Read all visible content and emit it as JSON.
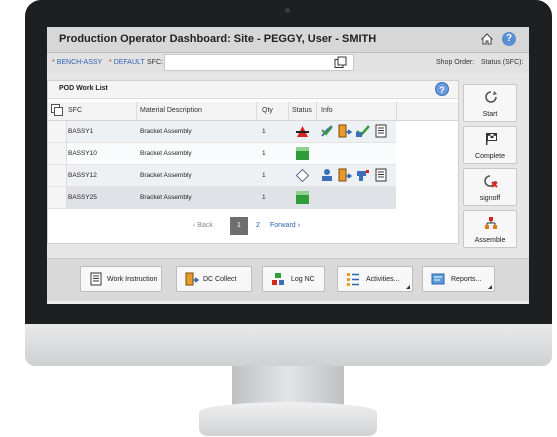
{
  "header": {
    "title": "Production Operator Dashboard: Site - PEGGY, User - SMITH",
    "home_icon": "home-icon",
    "help_icon": "help-icon",
    "help_glyph": "?"
  },
  "input_bar": {
    "operation_value": "BENCH-ASSY",
    "resource_value": "DEFAULT",
    "sfc_label": "SFC:",
    "sfc_value": "",
    "shop_order_label": "Shop Order:",
    "status_label": "Status (SFC):",
    "bullet": "*"
  },
  "worklist": {
    "title": "POD Work List",
    "help_glyph": "?",
    "columns": [
      "SFC",
      "Material Description",
      "Qty",
      "Status",
      "Info"
    ],
    "rows": [
      {
        "sfc": "BASSY1",
        "description": "Bracket Assembly",
        "qty": "1",
        "status": "on-hold",
        "info": [
          "routing-icon",
          "dc-collect-icon",
          "check-icon",
          "work-instruction-icon"
        ]
      },
      {
        "sfc": "BASSY10",
        "description": "Bracket Assembly",
        "qty": "1",
        "status": "active",
        "info": []
      },
      {
        "sfc": "BASSY12",
        "description": "Bracket Assembly",
        "qty": "1",
        "status": "new",
        "info": [
          "user-icon",
          "dc-collect-icon",
          "nc-icon",
          "work-instruction-icon"
        ]
      },
      {
        "sfc": "BASSY25",
        "description": "Bracket Assembly",
        "qty": "1",
        "status": "active",
        "info": []
      }
    ],
    "pager": {
      "back": "Back",
      "current": "1",
      "next_page": "2",
      "forward": "Forward"
    }
  },
  "actions": [
    {
      "label": "Start",
      "icon": "start-icon"
    },
    {
      "label": "Complete",
      "icon": "complete-flag-icon"
    },
    {
      "label": "signoff",
      "icon": "signoff-icon"
    },
    {
      "label": "Assemble",
      "icon": "assemble-icon"
    }
  ],
  "toolbar": [
    {
      "label": "Work Instruction",
      "icon": "work-instruction-icon",
      "dropdown": false
    },
    {
      "label": "DC Collect",
      "icon": "dc-collect-icon",
      "dropdown": false
    },
    {
      "label": "Log NC",
      "icon": "log-nc-icon",
      "dropdown": false
    },
    {
      "label": "Activities...",
      "icon": "activities-icon",
      "dropdown": true
    },
    {
      "label": "Reports...",
      "icon": "reports-icon",
      "dropdown": true
    }
  ],
  "colors": {
    "title_bar": "#d7d7d7",
    "bezel": "#1e1f21",
    "status_red": "#d6261c",
    "status_green": "#2f9e3a",
    "link_blue": "#2e64b0"
  }
}
